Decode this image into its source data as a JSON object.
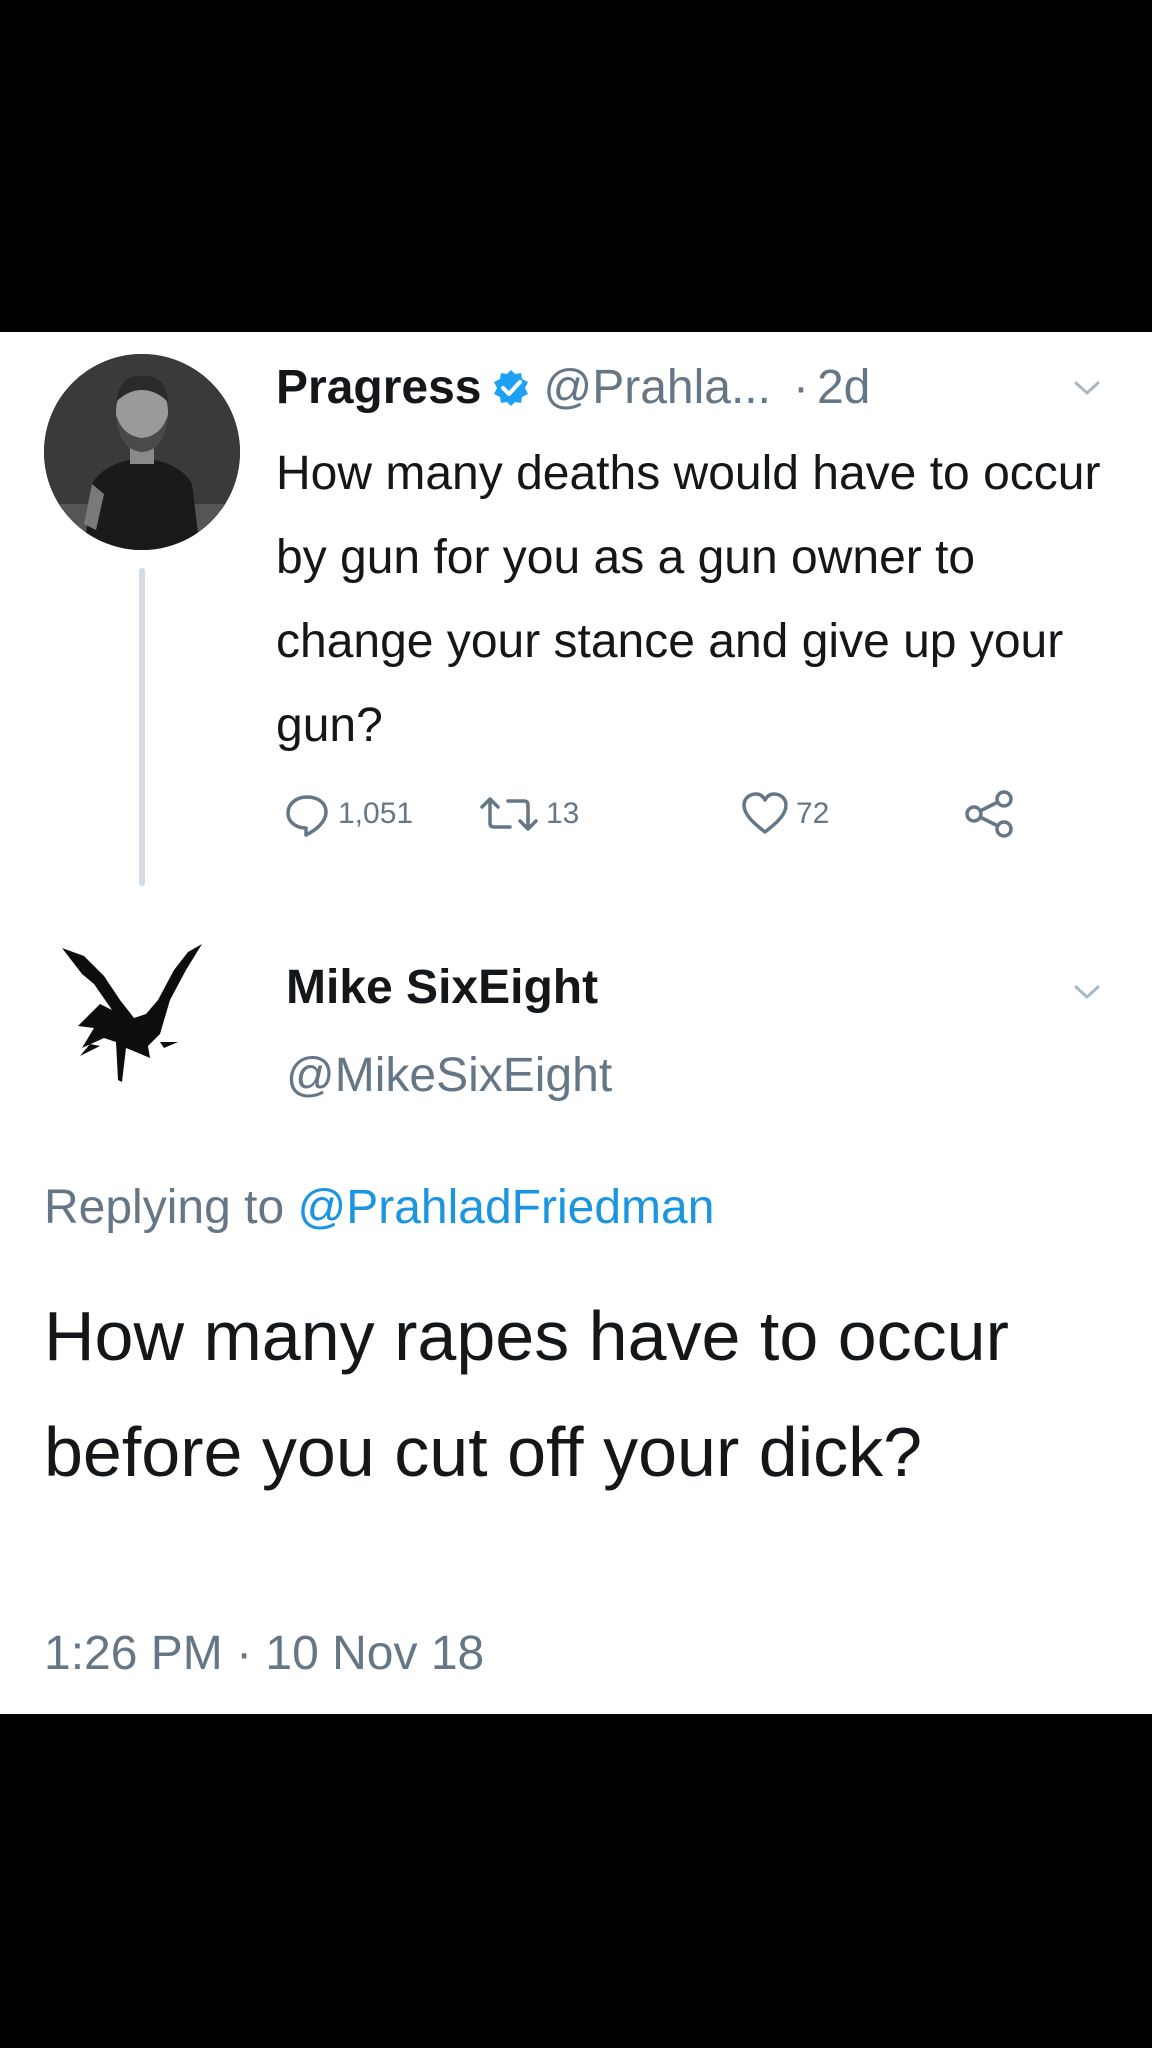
{
  "parent_tweet": {
    "display_name": "Pragress",
    "handle": "@Prahla...",
    "separator": "·",
    "time_ago": "2d",
    "text": "How many deaths would have to occur by gun for you as a gun owner to change your stance and give up your gun?",
    "replies": "1,051",
    "retweets": "13",
    "likes": "72",
    "verified": true,
    "avatar_icon": "person-photo-avatar",
    "colors": {
      "verified": "#1da1f2",
      "secondary_text": "#657786",
      "thread_line": "#d3dbe1"
    }
  },
  "reply_tweet": {
    "display_name": "Mike SixEight",
    "handle": "@MikeSixEight",
    "replying_label": "Replying to",
    "replying_to": "@PrahladFriedman",
    "text": "How many rapes have to occur before you cut off your dick?",
    "timestamp": "1:26 PM · 10 Nov 18",
    "avatar_icon": "raven-avatar",
    "colors": {
      "mention": "#1b95e0",
      "text": "#14171a"
    }
  }
}
